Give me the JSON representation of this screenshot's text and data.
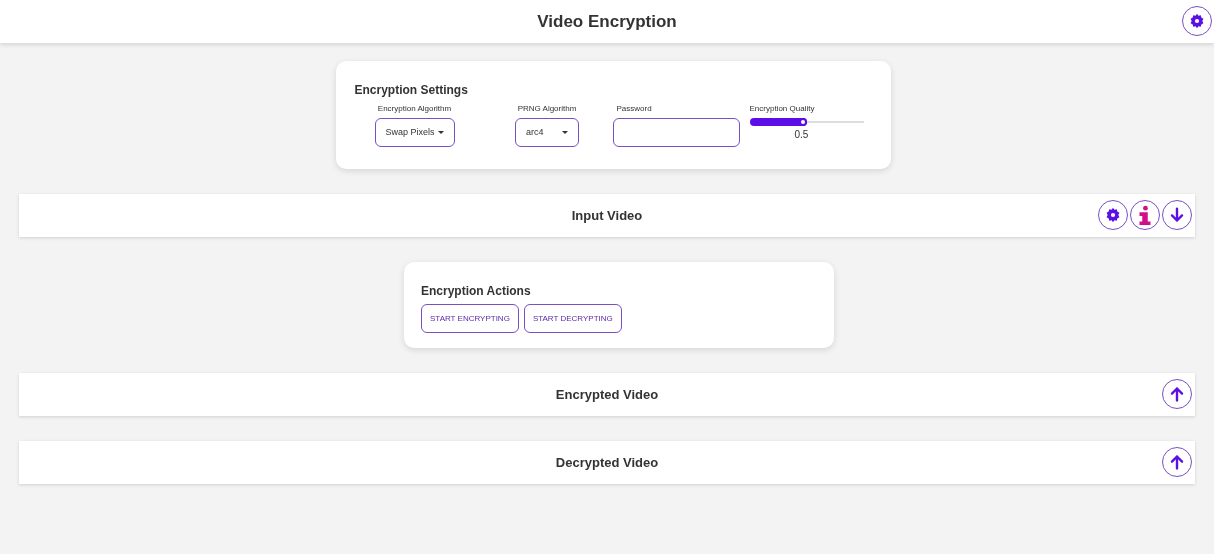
{
  "header": {
    "title": "Video Encryption",
    "buttons": [
      {
        "kind": "gear"
      }
    ]
  },
  "settings": {
    "title": "Encryption Settings",
    "algorithm": {
      "label": "Encryption Algorithm",
      "value": "Swap Pixels"
    },
    "prng": {
      "label": "PRNG Algorithm",
      "value": "arc4"
    },
    "password": {
      "label": "Password"
    },
    "quality": {
      "label": "Encryption Quality",
      "level": 0.5,
      "reading": "0.5"
    }
  },
  "input_section": {
    "title": "Input Video",
    "buttons": [
      {
        "kind": "gear"
      },
      {
        "kind": "info"
      },
      {
        "kind": "down"
      }
    ]
  },
  "actions": {
    "title": "Encryption Actions",
    "buttons": [
      "START ENCRYPTING",
      "START DECRYPTING"
    ]
  },
  "output_sections": [
    {
      "title": "Encrypted Video",
      "buttons": [
        {
          "kind": "up"
        }
      ]
    },
    {
      "title": "Decrypted Video",
      "buttons": [
        {
          "kind": "up"
        }
      ]
    }
  ]
}
